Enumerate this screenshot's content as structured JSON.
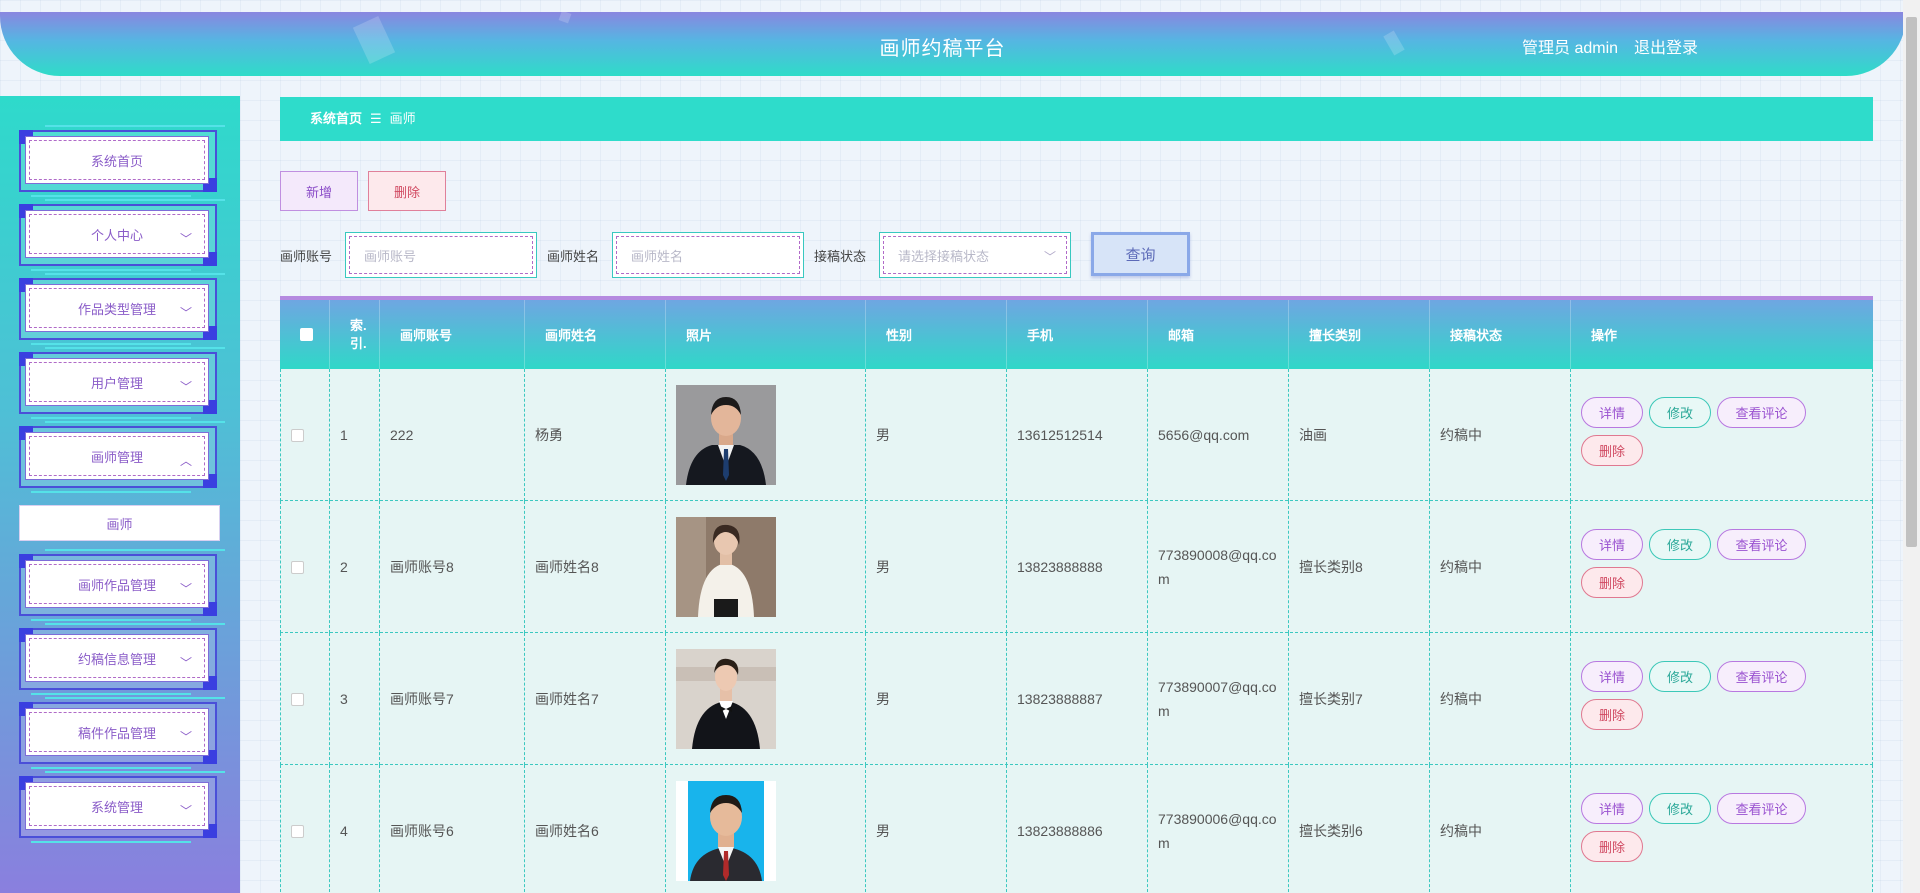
{
  "header": {
    "title": "画师约稿平台",
    "user_label": "管理员 admin",
    "logout_label": "退出登录"
  },
  "sidebar": {
    "items": [
      {
        "label": "系统首页",
        "chevron": ""
      },
      {
        "label": "个人中心",
        "chevron": "﹀"
      },
      {
        "label": "作品类型管理",
        "chevron": "﹀"
      },
      {
        "label": "用户管理",
        "chevron": "﹀"
      },
      {
        "label": "画师管理",
        "chevron": "︿"
      },
      {
        "label": "画师作品管理",
        "chevron": "﹀"
      },
      {
        "label": "约稿信息管理",
        "chevron": "﹀"
      },
      {
        "label": "稿件作品管理",
        "chevron": "﹀"
      },
      {
        "label": "系统管理",
        "chevron": "﹀"
      }
    ],
    "submenu_label": "画师"
  },
  "breadcrumb": {
    "home": "系统首页",
    "separator": "☰",
    "current": "画师"
  },
  "actions": {
    "add_label": "新增",
    "delete_label": "删除"
  },
  "search": {
    "account_label": "画师账号",
    "account_placeholder": "画师账号",
    "name_label": "画师姓名",
    "name_placeholder": "画师姓名",
    "status_label": "接稿状态",
    "status_placeholder": "请选择接稿状态",
    "query_label": "查询"
  },
  "table": {
    "headers": [
      "索.引.",
      "画师账号",
      "画师姓名",
      "照片",
      "性别",
      "手机",
      "邮箱",
      "擅长类别",
      "接稿状态",
      "操作"
    ],
    "op_labels": {
      "detail": "详情",
      "edit": "修改",
      "review": "查看评论",
      "delete": "删除"
    },
    "rows": [
      {
        "index": "1",
        "account": "222",
        "name": "杨勇",
        "photo": "man-in-suit-photo",
        "gender": "男",
        "phone": "13612512514",
        "email": "5656@qq.com",
        "category": "油画",
        "status": "约稿中"
      },
      {
        "index": "2",
        "account": "画师账号8",
        "name": "画师姓名8",
        "photo": "woman-in-white-blouse-photo",
        "gender": "男",
        "phone": "13823888888",
        "email": "773890008@qq.com",
        "category": "擅长类别8",
        "status": "约稿中"
      },
      {
        "index": "3",
        "account": "画师账号7",
        "name": "画师姓名7",
        "photo": "man-in-tuxedo-photo",
        "gender": "男",
        "phone": "13823888887",
        "email": "773890007@qq.com",
        "category": "擅长类别7",
        "status": "约稿中"
      },
      {
        "index": "4",
        "account": "画师账号6",
        "name": "画师姓名6",
        "photo": "man-id-photo-blue-background",
        "gender": "男",
        "phone": "13823888886",
        "email": "773890006@qq.com",
        "category": "擅长类别6",
        "status": "约稿中"
      }
    ]
  }
}
